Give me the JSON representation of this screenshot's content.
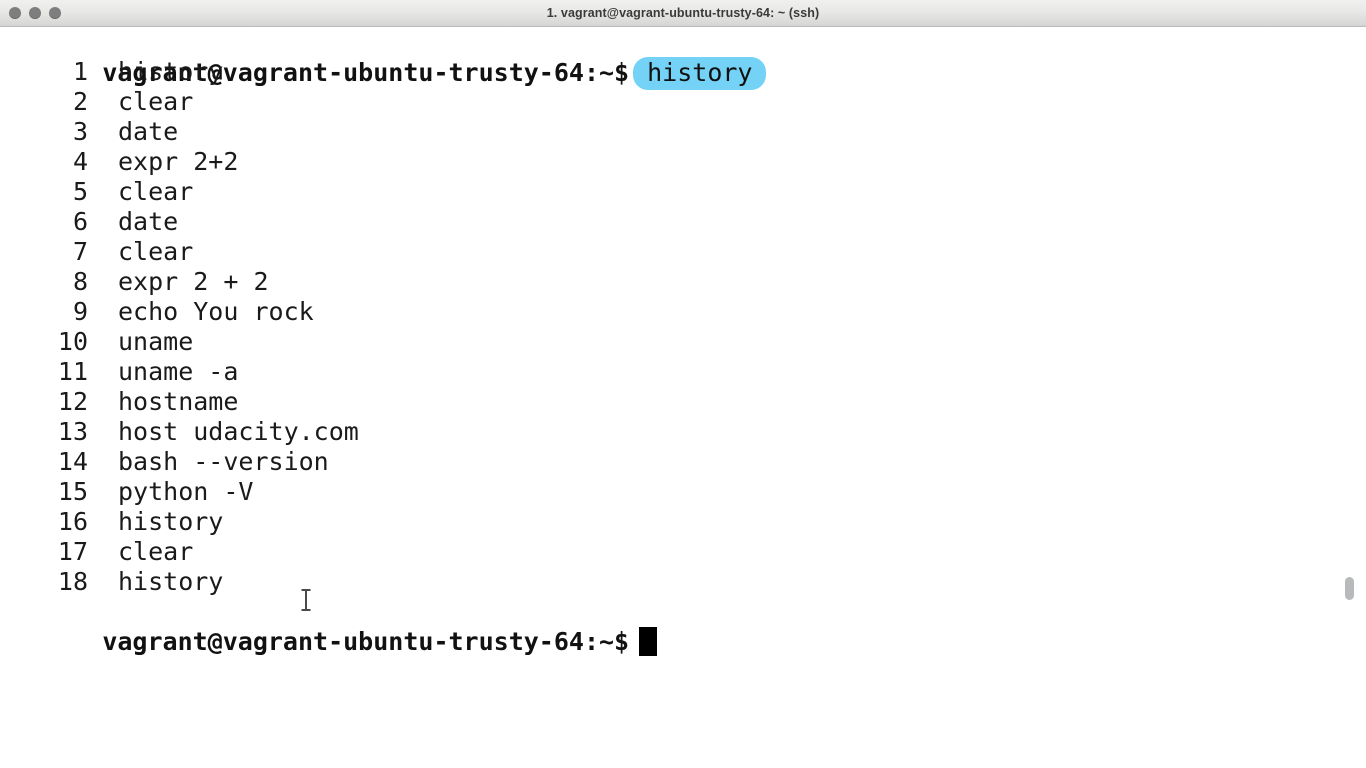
{
  "window": {
    "title": "1. vagrant@vagrant-ubuntu-trusty-64: ~ (ssh)",
    "traffic_lights": [
      {
        "name": "close",
        "color": "#7e7e7e"
      },
      {
        "name": "minimize",
        "color": "#7e7e7e"
      },
      {
        "name": "zoom",
        "color": "#7e7e7e"
      }
    ]
  },
  "terminal": {
    "background_color": "#ffffff",
    "foreground_color": "#1a1a1a",
    "highlight_color": "#73d2f5",
    "prompt": "vagrant@vagrant-ubuntu-trusty-64:~$",
    "entered_command": "history",
    "history": [
      {
        "num": "1",
        "command": "history"
      },
      {
        "num": "2",
        "command": "clear"
      },
      {
        "num": "3",
        "command": "date"
      },
      {
        "num": "4",
        "command": "expr 2+2"
      },
      {
        "num": "5",
        "command": "clear"
      },
      {
        "num": "6",
        "command": "date"
      },
      {
        "num": "7",
        "command": "clear"
      },
      {
        "num": "8",
        "command": "expr 2 + 2"
      },
      {
        "num": "9",
        "command": "echo You rock"
      },
      {
        "num": "10",
        "command": "uname"
      },
      {
        "num": "11",
        "command": "uname -a"
      },
      {
        "num": "12",
        "command": "hostname"
      },
      {
        "num": "13",
        "command": "host udacity.com"
      },
      {
        "num": "14",
        "command": "bash --version"
      },
      {
        "num": "15",
        "command": "python -V"
      },
      {
        "num": "16",
        "command": "history"
      },
      {
        "num": "17",
        "command": "clear"
      },
      {
        "num": "18",
        "command": "history"
      }
    ],
    "final_prompt": "vagrant@vagrant-ubuntu-trusty-64:~$",
    "cursor": "block"
  }
}
